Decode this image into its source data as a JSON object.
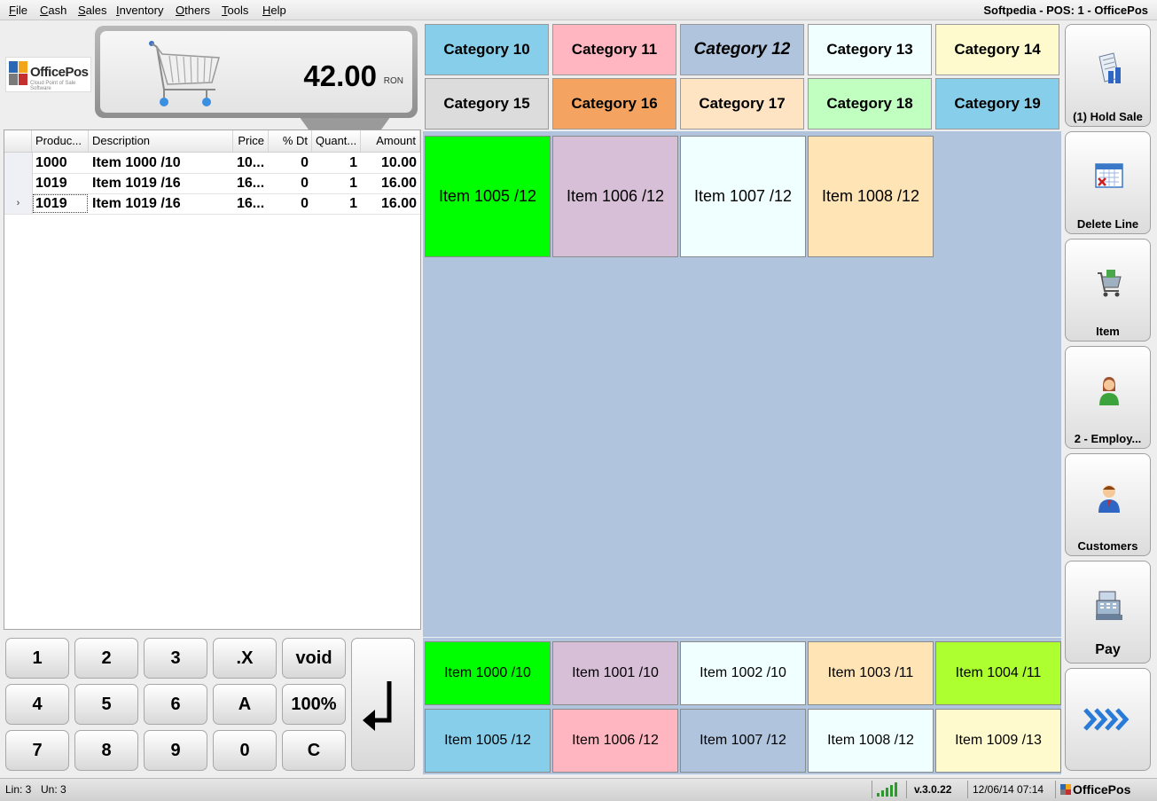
{
  "menu": [
    "File",
    "Cash",
    "Sales",
    "Inventory",
    "Others",
    "Tools",
    "Help"
  ],
  "app_title": "Softpedia - POS: 1 - OfficePos",
  "logo": {
    "name": "OfficePos",
    "tagline": "Cloud Point of Sale Software"
  },
  "total": {
    "amount": "42.00",
    "currency": "RON"
  },
  "grid": {
    "columns": [
      "Produc...",
      "Description",
      "Price",
      "% Dt",
      "Quant...",
      "Amount"
    ],
    "rows": [
      {
        "marker": "",
        "product": "1000",
        "description": "Item 1000 /10",
        "price": "10...",
        "discount": "0",
        "quantity": "1",
        "amount": "10.00"
      },
      {
        "marker": "",
        "product": "1019",
        "description": "Item 1019 /16",
        "price": "16...",
        "discount": "0",
        "quantity": "1",
        "amount": "16.00"
      },
      {
        "marker": "›",
        "product": "1019",
        "description": "Item 1019 /16",
        "price": "16...",
        "discount": "0",
        "quantity": "1",
        "amount": "16.00"
      }
    ]
  },
  "keypad": [
    "1",
    "2",
    "3",
    ".X",
    "void",
    "4",
    "5",
    "6",
    "A",
    "100%",
    "7",
    "8",
    "9",
    "0",
    "C"
  ],
  "categories": [
    {
      "label": "Category 10",
      "color": "#87ceeb"
    },
    {
      "label": "Category 11",
      "color": "#ffb6c1"
    },
    {
      "label": "Category 12",
      "color": "#b0c4de"
    },
    {
      "label": "Category 13",
      "color": "#f0ffff"
    },
    {
      "label": "Category 14",
      "color": "#fffacd"
    },
    {
      "label": "Category 15",
      "color": "#dcdcdc"
    },
    {
      "label": "Category 16",
      "color": "#f4a460"
    },
    {
      "label": "Category 17",
      "color": "#ffe4c4"
    },
    {
      "label": "Category 18",
      "color": "#c1ffc1"
    },
    {
      "label": "Category 19",
      "color": "#87ceeb"
    }
  ],
  "items": [
    {
      "label": "Item 1005 /12",
      "color": "#00ff00"
    },
    {
      "label": "Item 1006 /12",
      "color": "#d8bfd8"
    },
    {
      "label": "Item 1007 /12",
      "color": "#f0ffff"
    },
    {
      "label": "Item 1008 /12",
      "color": "#ffe4b5"
    }
  ],
  "quick_items": [
    {
      "label": "Item 1000 /10",
      "color": "#00ff00"
    },
    {
      "label": "Item 1001 /10",
      "color": "#d8bfd8"
    },
    {
      "label": "Item 1002 /10",
      "color": "#f0ffff"
    },
    {
      "label": "Item 1003 /11",
      "color": "#ffe4b5"
    },
    {
      "label": "Item 1004 /11",
      "color": "#adff2f"
    },
    {
      "label": "Item 1005 /12",
      "color": "#87ceeb"
    },
    {
      "label": "Item 1006 /12",
      "color": "#ffb6c1"
    },
    {
      "label": "Item 1007 /12",
      "color": "#b0c4de"
    },
    {
      "label": "Item 1008 /12",
      "color": "#f0ffff"
    },
    {
      "label": "Item 1009 /13",
      "color": "#fffacd"
    }
  ],
  "side_buttons": {
    "hold": "(1) Hold Sale",
    "delete": "Delete Line",
    "item": "Item",
    "employee": "2 - Employ...",
    "customers": "Customers",
    "pay": "Pay"
  },
  "status": {
    "lines": "Lin: 3",
    "units": "Un: 3",
    "version": "v.3.0.22",
    "datetime": "12/06/14 07:14",
    "brand": "OfficePos"
  }
}
